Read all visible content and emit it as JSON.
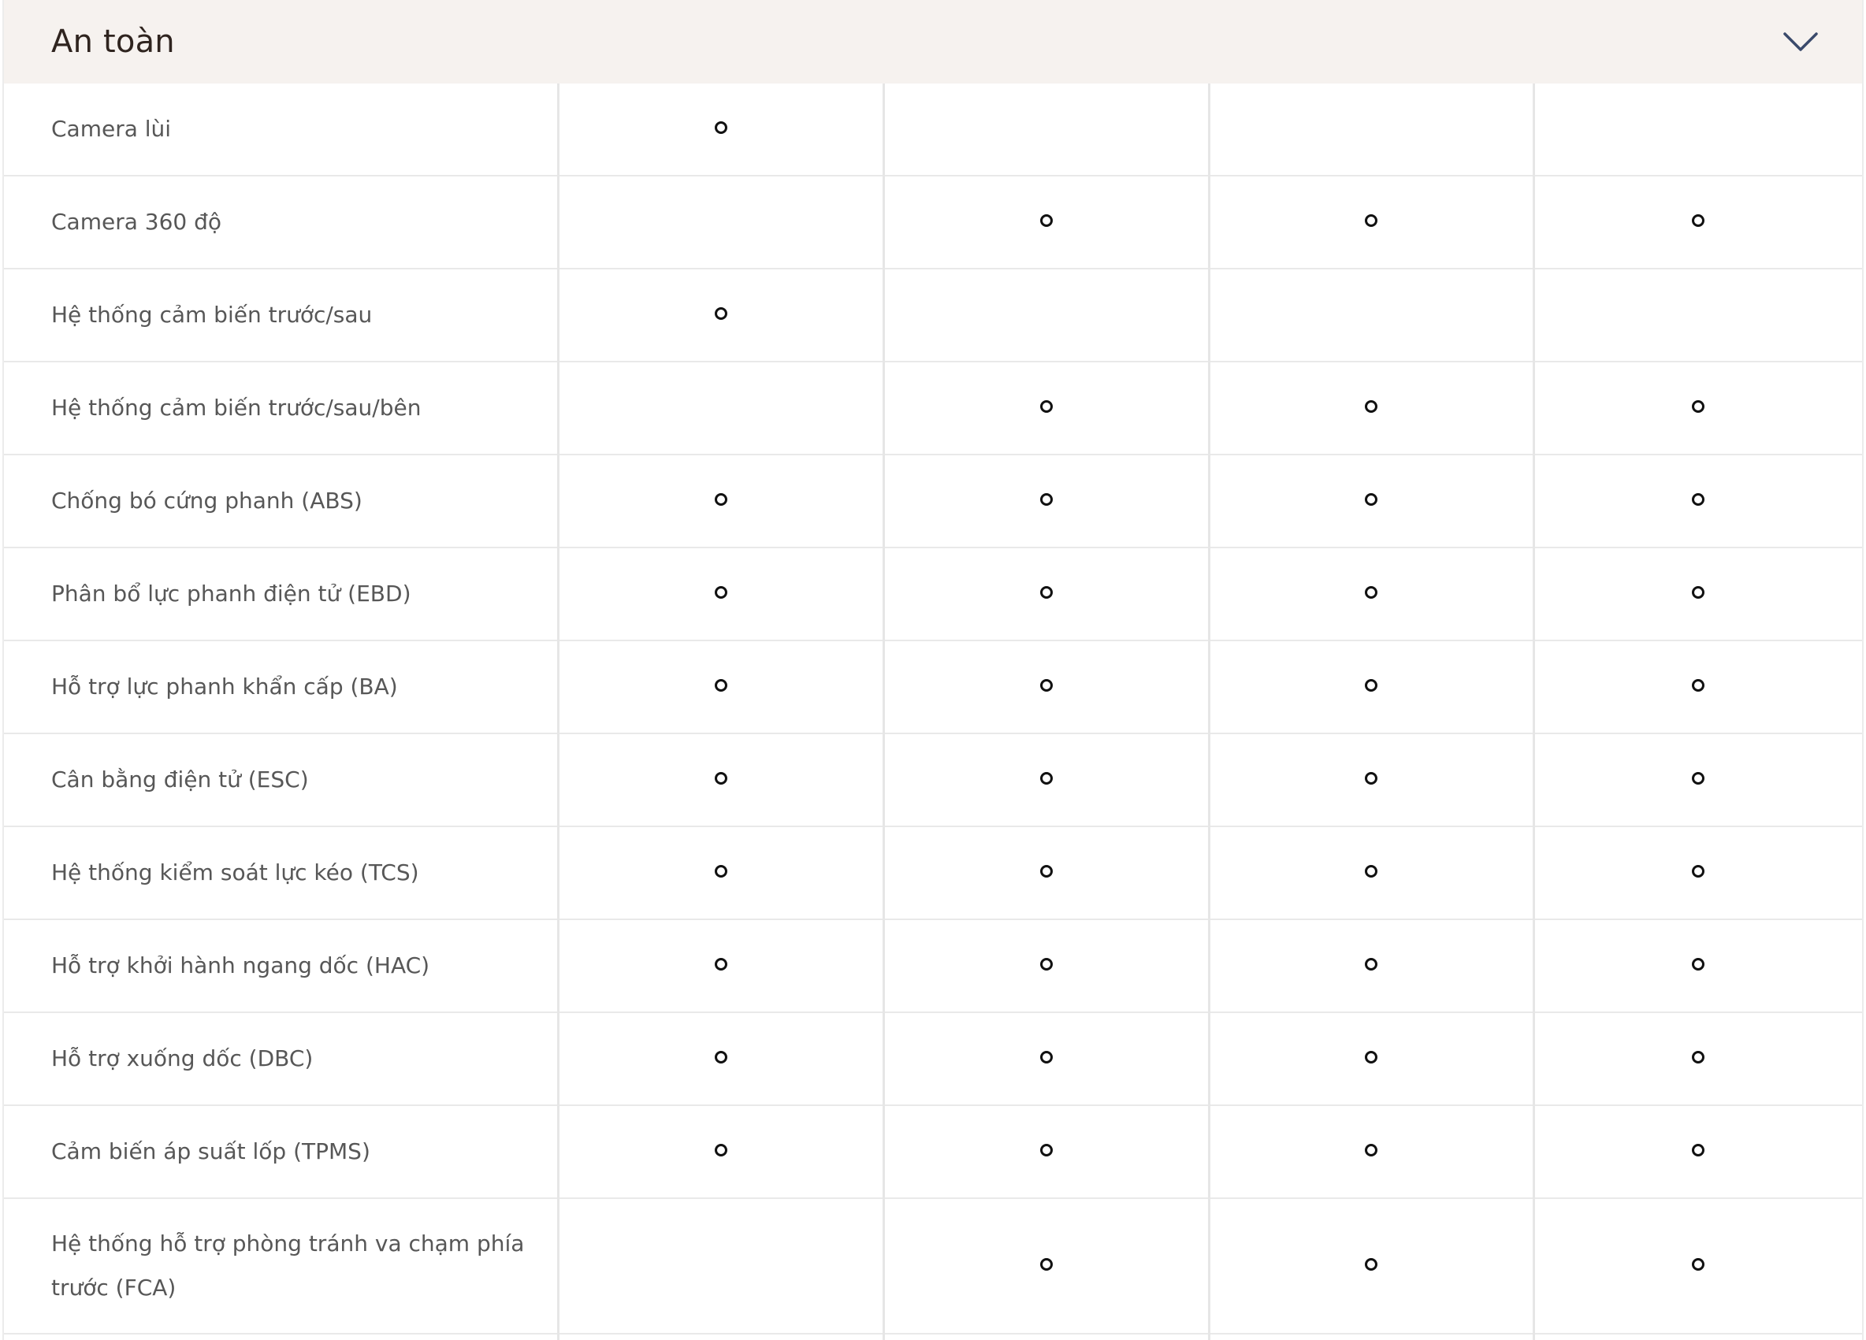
{
  "section": {
    "title": "An toàn",
    "toggle_icon": "chevron-down-icon"
  },
  "rows": [
    {
      "label": "Camera lùi",
      "marks": [
        true,
        false,
        false,
        false
      ]
    },
    {
      "label": "Camera 360 độ",
      "marks": [
        false,
        true,
        true,
        true
      ]
    },
    {
      "label": "Hệ thống cảm biến trước/sau",
      "marks": [
        true,
        false,
        false,
        false
      ]
    },
    {
      "label": "Hệ thống cảm biến trước/sau/bên",
      "marks": [
        false,
        true,
        true,
        true
      ]
    },
    {
      "label": "Chống bó cứng phanh (ABS)",
      "marks": [
        true,
        true,
        true,
        true
      ]
    },
    {
      "label": "Phân bổ lực phanh điện tử (EBD)",
      "marks": [
        true,
        true,
        true,
        true
      ]
    },
    {
      "label": "Hỗ trợ lực phanh khẩn cấp (BA)",
      "marks": [
        true,
        true,
        true,
        true
      ]
    },
    {
      "label": "Cân bằng điện tử (ESC)",
      "marks": [
        true,
        true,
        true,
        true
      ]
    },
    {
      "label": "Hệ thống kiểm soát lực kéo (TCS)",
      "marks": [
        true,
        true,
        true,
        true
      ]
    },
    {
      "label": "Hỗ trợ khởi hành ngang dốc (HAC)",
      "marks": [
        true,
        true,
        true,
        true
      ]
    },
    {
      "label": "Hỗ trợ xuống dốc (DBC)",
      "marks": [
        true,
        true,
        true,
        true
      ]
    },
    {
      "label": "Cảm biến áp suất lốp (TPMS)",
      "marks": [
        true,
        true,
        true,
        true
      ]
    },
    {
      "label": "Hệ thống hỗ trợ phòng tránh va chạm phía trước (FCA)",
      "marks": [
        false,
        true,
        true,
        true
      ]
    }
  ],
  "colors": {
    "header_bg": "#f6f2ef",
    "title": "#2f241f",
    "label": "#575757",
    "mark": "#111111",
    "chevron": "#3a4a6b"
  }
}
